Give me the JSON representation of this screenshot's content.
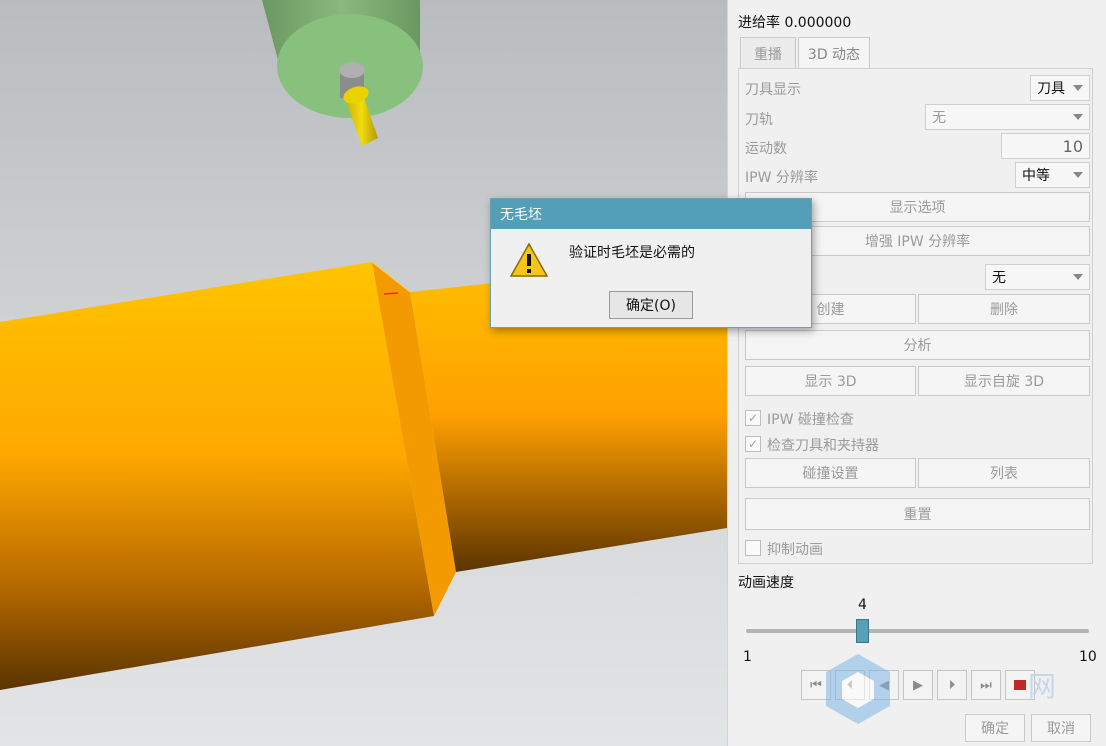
{
  "feed_rate": "进给率 0.000000",
  "tabs": [
    "重播",
    "3D 动态"
  ],
  "rows": {
    "tool_display": {
      "label": "刀具显示",
      "value": "刀具"
    },
    "toolpath": {
      "label": "刀轨",
      "value": "无"
    },
    "motion_count": {
      "label": "运动数",
      "value": "10"
    },
    "ipw_resolution": {
      "label": "IPW 分辨率",
      "value": "中等"
    }
  },
  "buttons": {
    "display_options": "显示选项",
    "enhance_ipw": "增强 IPW 分辨率",
    "create": "创建",
    "delete": "删除",
    "analyze": "分析",
    "show_3d": "显示 3D",
    "show_self_rotate_3d": "显示自旋 3D",
    "collision_settings": "碰撞设置",
    "list": "列表",
    "reset": "重置",
    "ok": "确定",
    "cancel": "取消"
  },
  "ipw_combo_value": "无",
  "checkboxes": {
    "ipw_collision": {
      "label": "IPW 碰撞检查",
      "checked": true
    },
    "check_tool_holder": {
      "label": "检查刀具和夹持器",
      "checked": true
    },
    "suppress_animation": {
      "label": "抑制动画",
      "checked": false
    }
  },
  "animation_speed": {
    "label": "动画速度",
    "value": "4",
    "min": "1",
    "max": "10"
  },
  "dialog": {
    "title": "无毛坯",
    "message": "验证时毛坯是必需的",
    "ok_label": "确定(O)"
  },
  "watermark": "网",
  "colors": {
    "dialog_title": "#539fb8",
    "workpiece": "#ffa500",
    "tool_holder": "#86b77a",
    "slider_thumb": "#5a9fb8"
  }
}
